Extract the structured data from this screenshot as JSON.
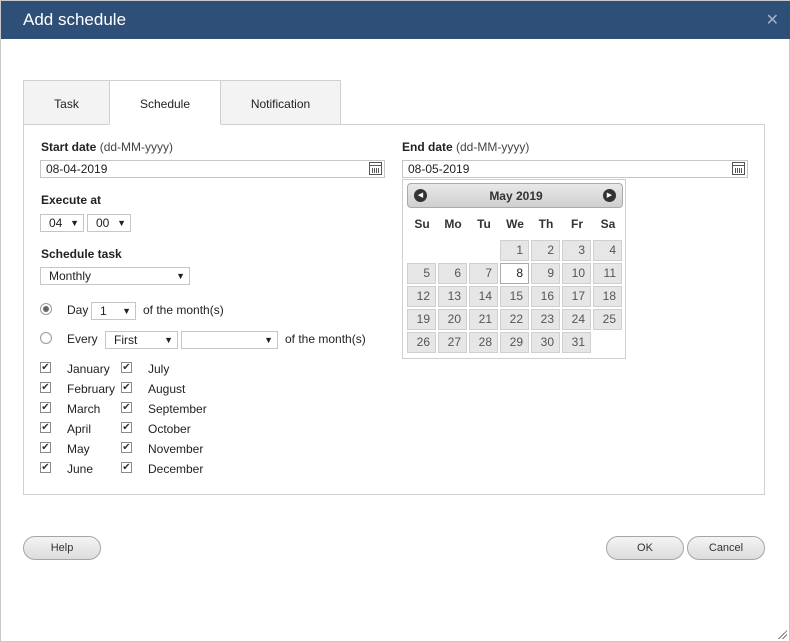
{
  "dialog": {
    "title": "Add schedule"
  },
  "tabs": [
    {
      "label": "Task"
    },
    {
      "label": "Schedule"
    },
    {
      "label": "Notification"
    }
  ],
  "start_date": {
    "label": "Start date",
    "format_hint": "(dd-MM-yyyy)",
    "value": "08-04-2019"
  },
  "end_date": {
    "label": "End date",
    "format_hint": "(dd-MM-yyyy)",
    "value": "08-05-2019"
  },
  "execute_at": {
    "label": "Execute at",
    "hour": "04",
    "minute": "00"
  },
  "schedule_task": {
    "label": "Schedule task",
    "value": "Monthly"
  },
  "day_option": {
    "label": "Day",
    "value": "1",
    "suffix": "of the month(s)",
    "selected": true
  },
  "every_option": {
    "label": "Every",
    "ordinal": "First",
    "weekday": "",
    "suffix": "of the month(s)",
    "selected": false
  },
  "months_left": [
    "January",
    "February",
    "March",
    "April",
    "May",
    "June"
  ],
  "months_right": [
    "July",
    "August",
    "September",
    "October",
    "November",
    "December"
  ],
  "calendar": {
    "month_label": "May 2019",
    "weekdays": [
      "Su",
      "Mo",
      "Tu",
      "We",
      "Th",
      "Fr",
      "Sa"
    ],
    "days": [
      "1",
      "2",
      "3",
      "4",
      "5",
      "6",
      "7",
      "8",
      "9",
      "10",
      "11",
      "12",
      "13",
      "14",
      "15",
      "16",
      "17",
      "18",
      "19",
      "20",
      "21",
      "22",
      "23",
      "24",
      "25",
      "26",
      "27",
      "28",
      "29",
      "30",
      "31"
    ],
    "first_weekday_index": 3,
    "selected_day": "8"
  },
  "buttons": {
    "help": "Help",
    "ok": "OK",
    "cancel": "Cancel"
  },
  "icons": {
    "close": "close-icon",
    "calendar": "calendar-icon",
    "prev": "chevron-left-icon",
    "next": "chevron-right-icon"
  }
}
